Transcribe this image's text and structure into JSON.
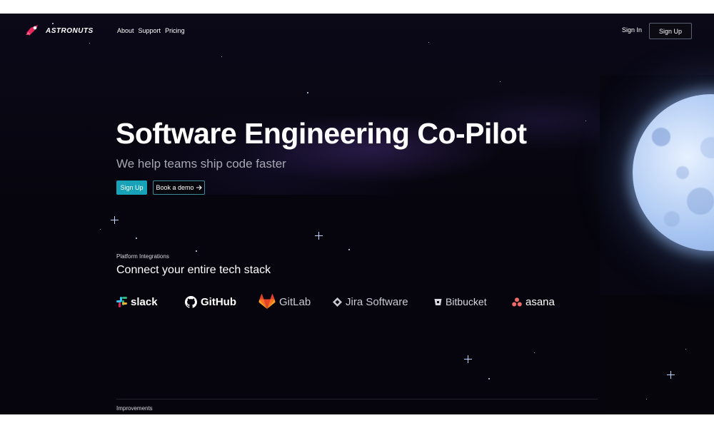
{
  "brand": {
    "name": "ASTRONUTS",
    "logo_icon": "astronaut-icon",
    "accent": "#e8265e"
  },
  "nav": {
    "items": [
      "About",
      "Support",
      "Pricing"
    ]
  },
  "header": {
    "signin_label": "Sign In",
    "signup_label": "Sign Up"
  },
  "hero": {
    "title": "Software Engineering Co-Pilot",
    "subtitle": "We help teams ship code faster",
    "primary_cta": "Sign Up",
    "secondary_cta": "Book a demo",
    "secondary_cta_icon": "arrow-right-icon",
    "cta_color": "#17a2b8"
  },
  "integrations": {
    "label": "Platform Integrations",
    "title": "Connect your entire tech stack",
    "logos": [
      "slack",
      "GitHub",
      "GitLab",
      "Jira Software",
      "Bitbucket",
      "asana"
    ]
  },
  "next_section": {
    "label": "Improvements"
  },
  "colors": {
    "background": "#05040b",
    "moon": "#a9c6f2",
    "text": "#ffffff",
    "muted": "#a6a8b4"
  }
}
